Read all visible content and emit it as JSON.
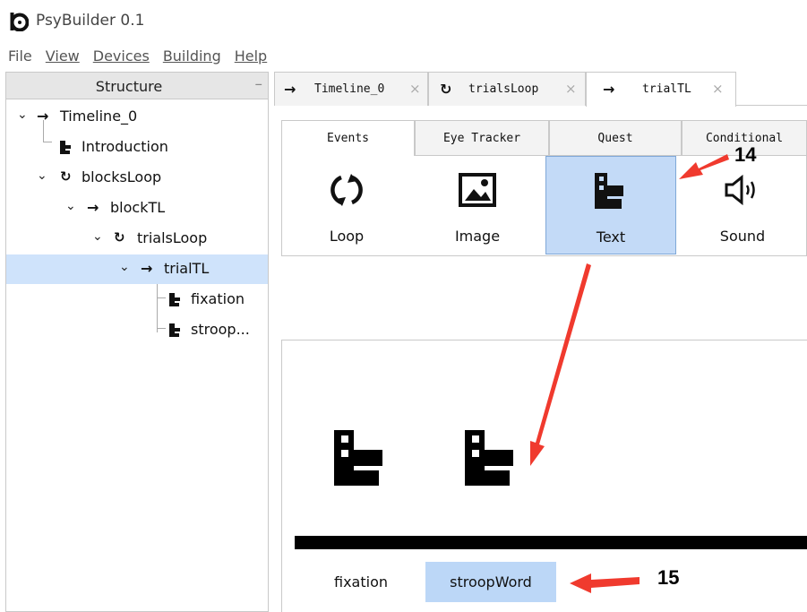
{
  "app": {
    "title": "PsyBuilder 0.1",
    "logo_icon": "psybuilder-logo-icon"
  },
  "menu": [
    {
      "label": "File",
      "underlined": false
    },
    {
      "label": "View",
      "underlined": true
    },
    {
      "label": "Devices",
      "underlined": true
    },
    {
      "label": "Building",
      "underlined": true
    },
    {
      "label": "Help",
      "underlined": true
    }
  ],
  "structure": {
    "title": "Structure",
    "collapse_glyph": "–",
    "tree": [
      {
        "label": "Timeline_0",
        "icon": "arrow-right-icon",
        "expanded": true
      },
      {
        "label": "Introduction",
        "icon": "text-event-icon"
      },
      {
        "label": "blocksLoop",
        "icon": "loop-icon",
        "expanded": true
      },
      {
        "label": "blockTL",
        "icon": "arrow-right-icon",
        "expanded": true
      },
      {
        "label": "trialsLoop",
        "icon": "loop-icon",
        "expanded": true
      },
      {
        "label": "trialTL",
        "icon": "arrow-right-icon",
        "expanded": true,
        "selected": true
      },
      {
        "label": "fixation",
        "icon": "text-event-icon"
      },
      {
        "label": "stroop...",
        "icon": "text-event-icon"
      }
    ]
  },
  "tabs": [
    {
      "label": "Timeline_0",
      "icon": "arrow-right-icon",
      "close": "×"
    },
    {
      "label": "trialsLoop",
      "icon": "loop-icon",
      "close": "×"
    },
    {
      "label": "trialTL",
      "icon": "arrow-right-icon",
      "close": "×",
      "active": true
    }
  ],
  "category_tabs": [
    {
      "label": "Events",
      "active": true
    },
    {
      "label": "Eye Tracker"
    },
    {
      "label": "Quest"
    },
    {
      "label": "Conditional"
    }
  ],
  "events": [
    {
      "label": "Loop",
      "icon": "loop-icon"
    },
    {
      "label": "Image",
      "icon": "image-icon"
    },
    {
      "label": "Text",
      "icon": "text-event-icon",
      "highlighted": true
    },
    {
      "label": "Sound",
      "icon": "speaker-icon"
    }
  ],
  "timeline": {
    "items": [
      {
        "label": "fixation",
        "icon": "text-event-icon"
      },
      {
        "label": "stroopWord",
        "icon": "text-event-icon",
        "selected": true
      }
    ]
  },
  "annotations": {
    "first": "14",
    "second": "15",
    "arrow_color": "#f03a2e"
  },
  "colors": {
    "selection": "#cfe3fb",
    "highlight": "#c3daf7",
    "annotation_arrow": "#f03a2e"
  }
}
